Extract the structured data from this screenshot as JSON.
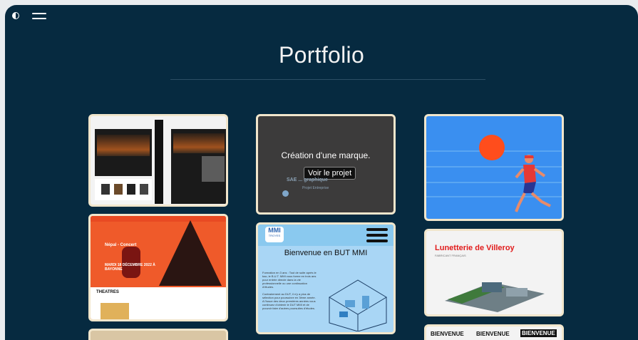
{
  "page": {
    "title": "Portfolio"
  },
  "icons": {
    "theme": "contrast-icon",
    "menu": "hamburger-menu-icon"
  },
  "projects": {
    "marque": {
      "caption": "Création d'une marque.",
      "button": "Voir le projet",
      "bg_text": "SAE ... graphique",
      "bg_sub": "Projet Entreprise"
    },
    "mmi": {
      "logo": "MMI",
      "logo_sub": "TROYES",
      "headline": "Bienvenue en BUT MMI",
      "p1": "Formation en 3 ans : Tout de suite après le bac, le B.U.T. MMI vous forme en trois ans pour entrée directe dans la vie professionnelle ou une continuation d'études.",
      "p2": "Contrairement au DUT, il n'y a plus de sélection pour poursuivre en 3ème année. A l'issue des deux premières années vous continuez d'obtenir le DUT MMI et de pouvoir faire d'autres poursuites d'études."
    },
    "concert": {
      "title": "Népal - Concert",
      "date": "MARDI 18 DÉCEMBRE 2022 À BAYONNE",
      "section": "THEATRES"
    },
    "lunetterie": {
      "title": "Lunetterie de Villeroy",
      "subtitle": "FABRICANT FRANÇAIS"
    },
    "bienvenue": {
      "w1": "BIENVENUE",
      "w2": "BIENVENUE",
      "w3": "BIENVENUE"
    }
  },
  "colors": {
    "background": "#062a40",
    "card_border": "#f1e6cc"
  }
}
